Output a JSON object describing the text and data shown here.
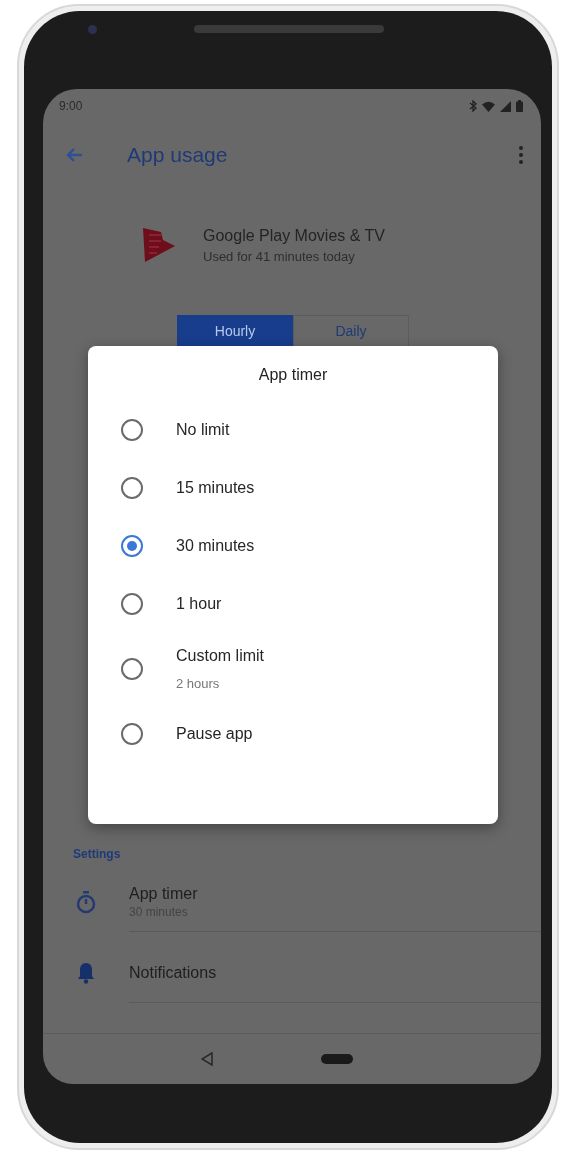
{
  "status_bar": {
    "time": "9:00"
  },
  "app_bar": {
    "title": "App usage"
  },
  "app": {
    "name": "Google Play Movies & TV",
    "usage": "Used for 41 minutes today"
  },
  "tabs": [
    {
      "label": "Hourly",
      "selected": true
    },
    {
      "label": "Daily",
      "selected": false
    }
  ],
  "dialog": {
    "title": "App timer",
    "options": [
      {
        "label": "No limit",
        "selected": false
      },
      {
        "label": "15 minutes",
        "selected": false
      },
      {
        "label": "30 minutes",
        "selected": true
      },
      {
        "label": "1 hour",
        "selected": false
      },
      {
        "label": "Custom limit",
        "detail": "2 hours",
        "selected": false
      },
      {
        "label": "Pause app",
        "selected": false
      }
    ]
  },
  "settings": {
    "heading": "Settings",
    "items": [
      {
        "kind": "timer",
        "title": "App timer",
        "subtitle": "30 minutes"
      },
      {
        "kind": "notifications",
        "title": "Notifications"
      }
    ]
  }
}
